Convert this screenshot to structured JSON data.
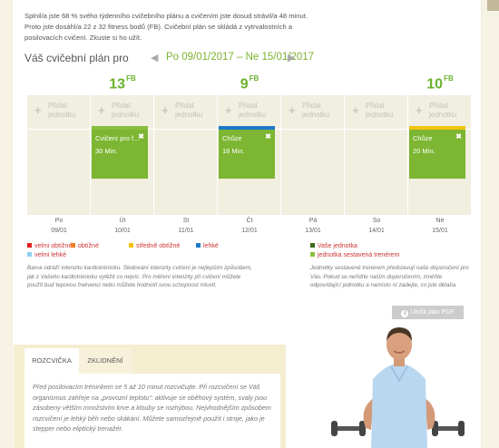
{
  "intro": {
    "line1": "Splnil/a jste 68 % svého týdenního cvičebního plánu a cvičením jste dosud strávil/a 48 minut.",
    "line2": "Proto jste dosáhl/a 22 z 32 fitness bodů (FB). Cvičební plán se skládá z vytrvalostních a posilovacích cvičení. Zkuste si ho užít."
  },
  "plan": {
    "title": "Váš cvičební plán pro",
    "prev": "◀",
    "range": "Po 09/01/2017 – Ne 15/01/2017",
    "next": "▶"
  },
  "scores": [
    {
      "value": "13",
      "unit": "FB"
    },
    {
      "value": "9",
      "unit": "FB"
    },
    {
      "value": "10",
      "unit": "FB"
    }
  ],
  "add_label_1": "Přidat",
  "add_label_2": "jednotku",
  "days": [
    {
      "name": "Po",
      "date": "09/01"
    },
    {
      "name": "Út",
      "date": "10/01"
    },
    {
      "name": "St",
      "date": "11/01"
    },
    {
      "name": "Čt",
      "date": "12/01"
    },
    {
      "name": "Pá",
      "date": "13/01"
    },
    {
      "name": "So",
      "date": "14/01"
    },
    {
      "name": "Ne",
      "date": "15/01"
    }
  ],
  "entries": [
    {
      "title": "Cvičení pro f...",
      "duration": "30 Min.",
      "close": "✖",
      "bar_color": "#8bbf3f"
    },
    {
      "title": "Chůze",
      "duration": "18 Min.",
      "close": "✖",
      "bar_color": "#1f78c8"
    },
    {
      "title": "Chůze",
      "duration": "20 Min.",
      "close": "✖",
      "bar_color": "#f1c40f"
    }
  ],
  "legend": {
    "intensity": [
      {
        "label": "velmi obtížné",
        "color": "#e02020"
      },
      {
        "label": "obtížné",
        "color": "#f08020"
      },
      {
        "label": "středně obtížné",
        "color": "#f1c40f"
      },
      {
        "label": "lehké",
        "color": "#1f78c8"
      },
      {
        "label": "velmi lehké",
        "color": "#8fd0f0"
      }
    ],
    "units": [
      {
        "label": "Vaše jednotka",
        "color": "#3a6a1a"
      },
      {
        "label": "jednotka sestavená trenérem",
        "color": "#8bbf3f"
      }
    ],
    "intensity_note": "Barva odráží intenzitu kardiotréninku. Sledování intenzity cvičení je nejlepším způsobem, jak z Vašeho kardiotréninku vytěžit co nejvíc. Pro měření intenzity při cvičení můžete použít buď tepovou frekvenci nebo můžete hodnotit svou schopnost mluvit.",
    "units_note": "Jednotky sestavené trenérem představují naše doporučení pro Vás. Pokud se neřídíte naším doporučením, změňte odpovídající jednotku a namísto ní zadejte, co jste dělal/a."
  },
  "pdf_button": "Uložit jako PDF",
  "tabs": {
    "warmup": "ROZCVIČKA",
    "cooldown": "ZKLIDNĚNÍ"
  },
  "warmup_text": "Před posilovacím tréninkem se 5 až 10 minut rozcvičujte. Při rozcvičení se Váš organismus zahřeje na „provozní teplotu“: aktivuje se oběhový systém, svaly jsou zásobeny větším množstvím krve a klouby se rozhýbou. Nejvhodnějším způsobem rozcvičení je lehký běh nebo skákání. Můžete samozřejmě použít i stroje, jako je stepper nebo eliptický trenažér.",
  "colors": {
    "accent": "#7ab32e",
    "entry_bg": "#7cb632",
    "cell_bg": "#f1efe0"
  }
}
